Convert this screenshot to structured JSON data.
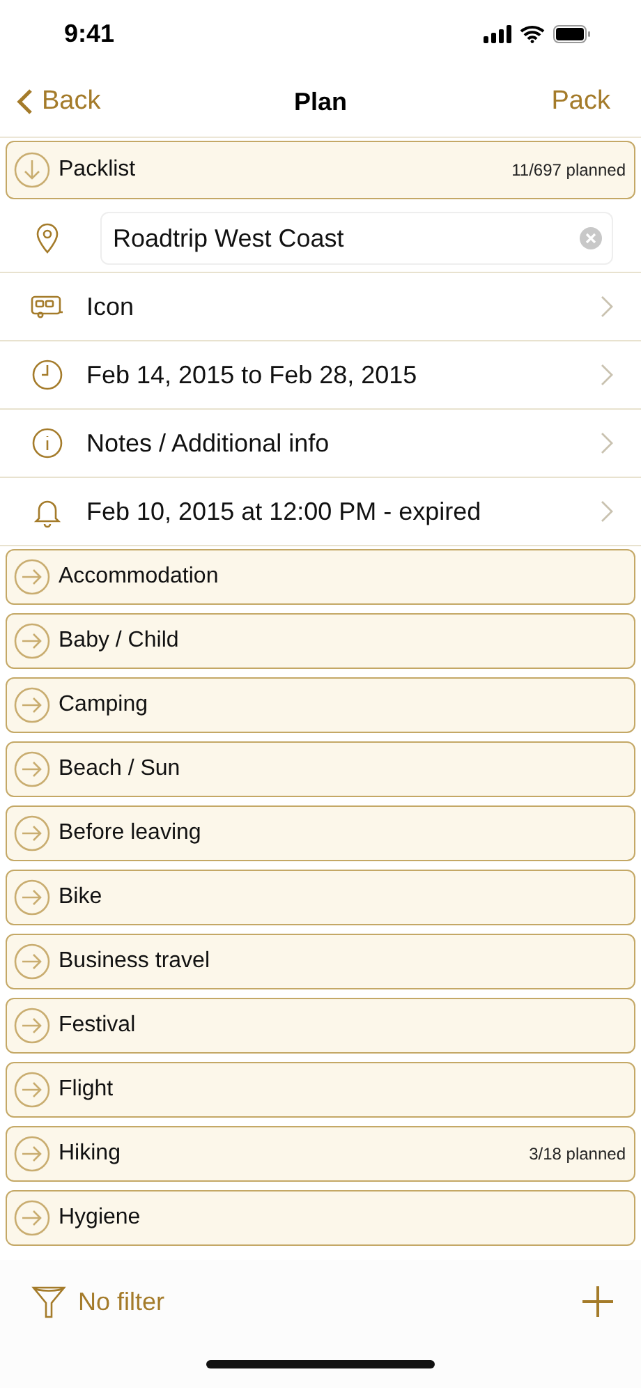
{
  "status_bar": {
    "time": "9:41"
  },
  "nav": {
    "back": "Back",
    "title": "Plan",
    "action": "Pack"
  },
  "packlist": {
    "label": "Packlist",
    "count": "11/697 planned"
  },
  "details": [
    {
      "kind": "location",
      "value": "Roadtrip West Coast"
    },
    {
      "kind": "icon",
      "label": "Icon"
    },
    {
      "kind": "dates",
      "label": "Feb 14, 2015 to Feb 28, 2015"
    },
    {
      "kind": "notes",
      "label": "Notes / Additional info"
    },
    {
      "kind": "alarm",
      "label": "Feb 10, 2015 at 12:00 PM - expired"
    }
  ],
  "categories": [
    {
      "label": "Accommodation"
    },
    {
      "label": "Baby / Child"
    },
    {
      "label": "Camping"
    },
    {
      "label": "Beach / Sun"
    },
    {
      "label": "Before leaving"
    },
    {
      "label": "Bike"
    },
    {
      "label": "Business travel"
    },
    {
      "label": "Festival"
    },
    {
      "label": "Flight"
    },
    {
      "label": "Hiking",
      "count": "3/18 planned"
    },
    {
      "label": "Hygiene"
    }
  ],
  "toolbar": {
    "filter": "No filter"
  }
}
